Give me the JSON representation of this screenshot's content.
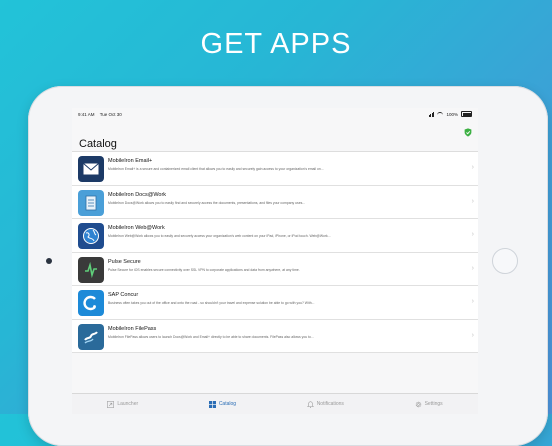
{
  "headline": "GET APPS",
  "status": {
    "time": "9:41 AM",
    "date": "Tue Oct 30",
    "battery": "100%"
  },
  "title": "Catalog",
  "apps": [
    {
      "name": "MobileIron Email+",
      "desc": "MobileIron Email+ is a secure and containerized email client that allows you to easily and securely gain access to your organization's email on..."
    },
    {
      "name": "MobileIron Docs@Work",
      "desc": "MobileIron Docs@Work allows you to easily find and securely access the documents, presentations, and files your company uses..."
    },
    {
      "name": "MobileIron Web@Work",
      "desc": "MobileIron Web@Work allows you to easily and securely access your organization's web content on your iPad, iPhone, or iPod touch. Web@Work..."
    },
    {
      "name": "Pulse Secure",
      "desc": "Pulse Secure for iOS enables secure connectivity over SSL VPN to corporate applications and data from anywhere, at any time."
    },
    {
      "name": "SAP Concur",
      "desc": "Business often takes you out of the office and onto the road - so shouldn't your travel and expense solution be able to go with you? With..."
    },
    {
      "name": "MobileIron FilePass",
      "desc": "MobileIron FilePass allows users to launch Docs@Work and Email+ directly to be able to share documents. FilePass also allows you to..."
    }
  ],
  "tabs": {
    "launcher": "Launcher",
    "catalog": "Catalog",
    "notifications": "Notifications",
    "settings": "Settings"
  },
  "colors": {
    "accent": "#2a6db5",
    "background_top": "#22c3d8",
    "background_bottom": "#4d93db"
  }
}
